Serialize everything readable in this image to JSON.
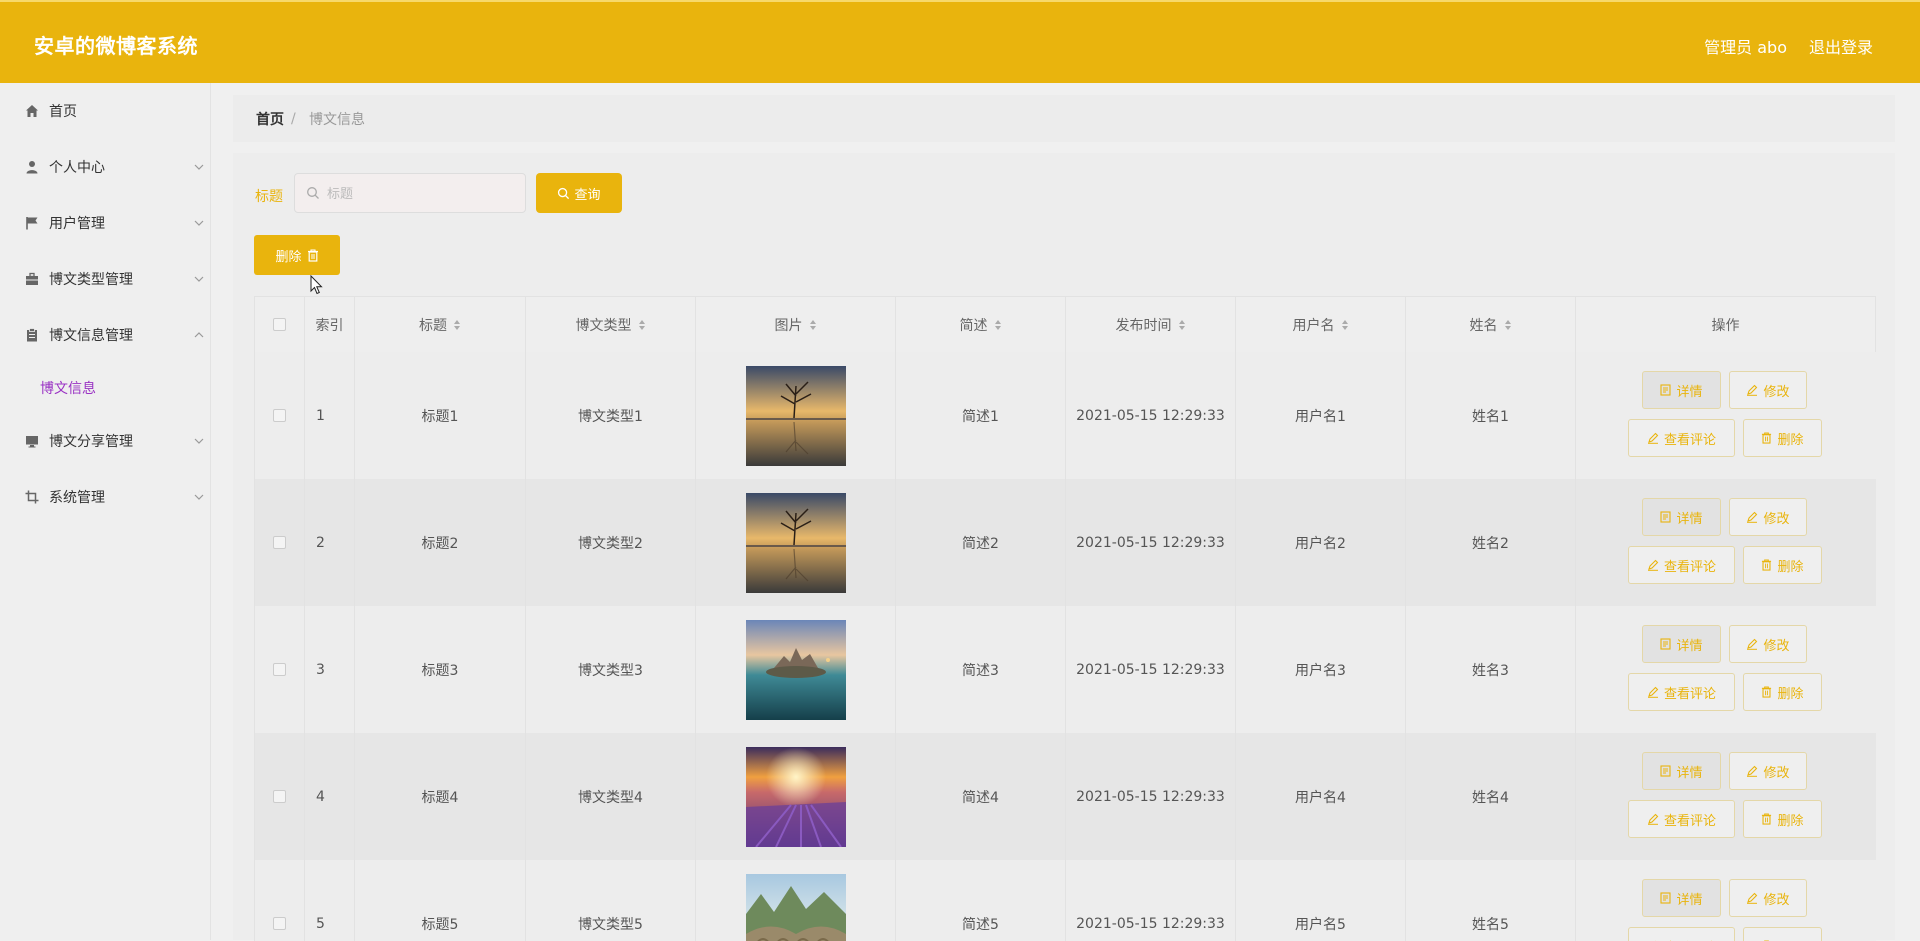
{
  "colors": {
    "brand": "#e9b40d",
    "submenu_active": "#9a32c4"
  },
  "header": {
    "app_title": "安卓的微博客系统",
    "user_label": "管理员 abo",
    "logout_label": "退出登录"
  },
  "sidebar": {
    "items": [
      {
        "label": "首页",
        "icon": "home-icon",
        "expandable": false
      },
      {
        "label": "个人中心",
        "icon": "user-icon",
        "expandable": true
      },
      {
        "label": "用户管理",
        "icon": "flag-icon",
        "expandable": true
      },
      {
        "label": "博文类型管理",
        "icon": "briefcase-icon",
        "expandable": true
      },
      {
        "label": "博文信息管理",
        "icon": "clipboard-icon",
        "expandable": true,
        "expanded": true
      },
      {
        "label": "博文分享管理",
        "icon": "monitor-icon",
        "expandable": true
      },
      {
        "label": "系统管理",
        "icon": "crop-icon",
        "expandable": true
      }
    ],
    "subitem": {
      "label": "博文信息"
    }
  },
  "breadcrumb": {
    "home": "首页",
    "separator": "/",
    "current": "博文信息"
  },
  "search": {
    "label": "标题",
    "placeholder": "标题",
    "value": "",
    "query_label": "查询"
  },
  "toolbar": {
    "delete_label": "删除"
  },
  "table": {
    "columns": [
      "索引",
      "标题",
      "博文类型",
      "图片",
      "简述",
      "发布时间",
      "用户名",
      "姓名",
      "操作"
    ],
    "op_labels": {
      "detail": "详情",
      "edit": "修改",
      "comments": "查看评论",
      "delete": "删除"
    },
    "rows": [
      {
        "index": "1",
        "title": "标题1",
        "type": "博文类型1",
        "image": "lone tree lake sunset",
        "summary": "简述1",
        "time": "2021-05-15 12:29:33",
        "username": "用户名1",
        "name": "姓名1"
      },
      {
        "index": "2",
        "title": "标题2",
        "type": "博文类型2",
        "image": "lone tree lake sunset",
        "summary": "简述2",
        "time": "2021-05-15 12:29:33",
        "username": "用户名2",
        "name": "姓名2"
      },
      {
        "index": "3",
        "title": "标题3",
        "type": "博文类型3",
        "image": "castle island lake",
        "summary": "简述3",
        "time": "2021-05-15 12:29:33",
        "username": "用户名3",
        "name": "姓名3"
      },
      {
        "index": "4",
        "title": "标题4",
        "type": "博文类型4",
        "image": "lavender field sunset",
        "summary": "简述4",
        "time": "2021-05-15 12:29:33",
        "username": "用户名4",
        "name": "姓名4"
      },
      {
        "index": "5",
        "title": "标题5",
        "type": "博文类型5",
        "image": "stone bridge mountains",
        "summary": "简述5",
        "time": "2021-05-15 12:29:33",
        "username": "用户名5",
        "name": "姓名5"
      }
    ]
  }
}
